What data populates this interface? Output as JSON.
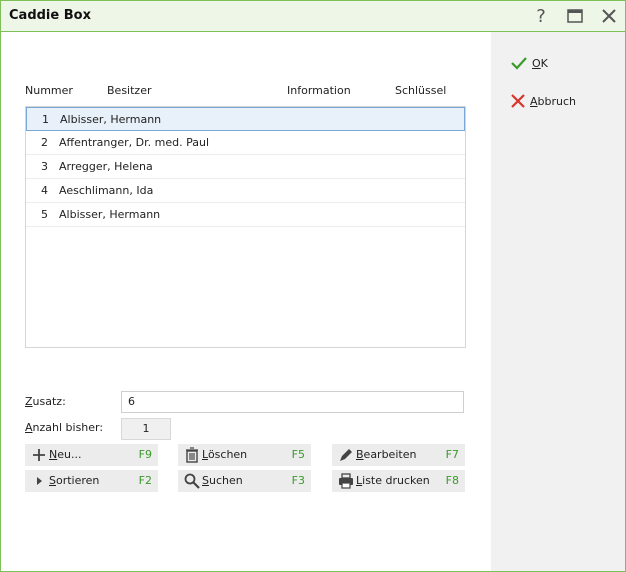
{
  "window": {
    "title": "Caddie Box"
  },
  "titlebar": {
    "icons": [
      "help-icon",
      "maximize-icon",
      "close-icon"
    ]
  },
  "side": {
    "ok": {
      "first": "O",
      "rest": "K"
    },
    "cancel": {
      "first": "A",
      "rest": "bbruch"
    }
  },
  "table": {
    "headers": [
      "Nummer",
      "Besitzer",
      "Information",
      "Schlüssel"
    ],
    "rows": [
      {
        "num": "1",
        "owner": "Albisser, Hermann"
      },
      {
        "num": "2",
        "owner": "Affentranger, Dr. med. Paul"
      },
      {
        "num": "3",
        "owner": "Arregger, Helena"
      },
      {
        "num": "4",
        "owner": "Aeschlimann, Ida"
      },
      {
        "num": "5",
        "owner": "Albisser, Hermann"
      }
    ]
  },
  "form": {
    "zusatz_first": "Z",
    "zusatz_rest": "usatz:",
    "zusatz_value": "6",
    "anzahl_first": "A",
    "anzahl_rest": "nzahl bisher:",
    "anzahl_value": "1"
  },
  "actions": {
    "neu": {
      "first": "N",
      "rest": "eu...",
      "key": "F9"
    },
    "loeschen": {
      "first": "L",
      "rest": "öschen",
      "key": "F5"
    },
    "bearbeiten": {
      "first": "B",
      "rest": "earbeiten",
      "key": "F7"
    },
    "sortieren": {
      "first": "S",
      "rest": "ortieren",
      "key": "F2"
    },
    "suchen": {
      "first": "S",
      "rest": "uchen",
      "key": "F3"
    },
    "liste": {
      "first": "L",
      "rest": "iste drucken",
      "key": "F8"
    }
  },
  "colors": {
    "accent_border": "#7fbf5a",
    "ok_green": "#3a9a2a",
    "cancel_red": "#d9342b",
    "selection": "#7aa7d8"
  }
}
